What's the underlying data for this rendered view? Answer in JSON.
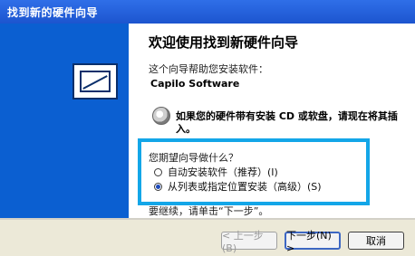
{
  "window": {
    "title": "找到新的硬件向导"
  },
  "content": {
    "heading": "欢迎使用找到新硬件向导",
    "intro": "这个向导帮助您安装软件：",
    "product": "Capilo Software",
    "cd_prompt": "如果您的硬件带有安装 CD 或软盘，请现在将其插入。",
    "question": "您期望向导做什么？",
    "options": [
      {
        "label": "自动安装软件（推荐）(I)",
        "selected": false
      },
      {
        "label": "从列表或指定位置安装（高级）(S)",
        "selected": true
      }
    ],
    "footer_text": "要继续，请单击“下一步”。"
  },
  "buttons": {
    "back": "< 上一步(B)",
    "next": "下一步(N) >",
    "cancel": "取消"
  },
  "icons": {
    "wizard": "hardware-wizard-icon",
    "cd": "cd-disc-icon"
  },
  "colors": {
    "titlebar": "#1c55cf",
    "leftpane": "#0b5fd1",
    "highlight": "#13a6e8"
  }
}
